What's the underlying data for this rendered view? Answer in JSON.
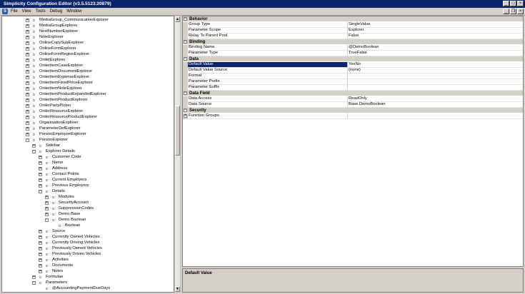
{
  "window": {
    "title": "Simplicity Configuration Editor (v3.5.5123.20879)",
    "min": "_",
    "max": "□",
    "close": "×"
  },
  "menu": {
    "app_icon": "S",
    "items": [
      "File",
      "View",
      "Tools",
      "Debug",
      "Window"
    ],
    "mdi": [
      "_",
      "❐",
      "×"
    ]
  },
  "tree": {
    "items": [
      {
        "label": "MediaGroup_CommunicationExplorer",
        "depth": 0,
        "exp": "+"
      },
      {
        "label": "MediaGroupExplorer",
        "depth": 0,
        "exp": "+"
      },
      {
        "label": "NextNumberExplorer",
        "depth": 0,
        "exp": "+"
      },
      {
        "label": "NoteExplorer",
        "depth": 0,
        "exp": "+"
      },
      {
        "label": "OnlineCopySubExplorer",
        "depth": 0,
        "exp": "+"
      },
      {
        "label": "OnlineFormExplorer",
        "depth": 0,
        "exp": "+"
      },
      {
        "label": "OnlineFormRegionExplorer",
        "depth": 0,
        "exp": "+"
      },
      {
        "label": "OrderExplorer",
        "depth": 0,
        "exp": "+"
      },
      {
        "label": "OrderItemCaseExplorer",
        "depth": 0,
        "exp": "+"
      },
      {
        "label": "OrderItemDocumentExplorer",
        "depth": 0,
        "exp": "+"
      },
      {
        "label": "OrderItemExpenseExplorer",
        "depth": 0,
        "exp": "+"
      },
      {
        "label": "OrderItemFixedPriceExplorer",
        "depth": 0,
        "exp": "+"
      },
      {
        "label": "OrderItemNoteExplorer",
        "depth": 0,
        "exp": "+"
      },
      {
        "label": "OrderItemProductExpandedExplorer",
        "depth": 0,
        "exp": "+"
      },
      {
        "label": "OrderItemProductExplorer",
        "depth": 0,
        "exp": "+"
      },
      {
        "label": "OrderPartyPicker",
        "depth": 0,
        "exp": "+"
      },
      {
        "label": "OrderResourceExplorer",
        "depth": 0,
        "exp": "+"
      },
      {
        "label": "OrderResourceProductExplorer",
        "depth": 0,
        "exp": "+"
      },
      {
        "label": "OrganisationExplorer",
        "depth": 0,
        "exp": "+"
      },
      {
        "label": "ParameterDefExplorer",
        "depth": 0,
        "exp": "+"
      },
      {
        "label": "PersonEmployeeExplorer",
        "depth": 0,
        "exp": "+"
      },
      {
        "label": "PersonExplorer",
        "depth": 0,
        "exp": "-"
      },
      {
        "label": "Sidebar",
        "depth": 1,
        "exp": "+"
      },
      {
        "label": "Explorer Details",
        "depth": 1,
        "exp": "-"
      },
      {
        "label": "Customer Code",
        "depth": 2,
        "exp": "+"
      },
      {
        "label": "Name",
        "depth": 2,
        "exp": "+"
      },
      {
        "label": "Address",
        "depth": 2,
        "exp": "+"
      },
      {
        "label": "Contact Points",
        "depth": 2,
        "exp": "+"
      },
      {
        "label": "Current Employers",
        "depth": 2,
        "exp": "+"
      },
      {
        "label": "Previous Employers",
        "depth": 2,
        "exp": "+"
      },
      {
        "label": "Details",
        "depth": 2,
        "exp": "-"
      },
      {
        "label": "Modules",
        "depth": 3,
        "exp": "+"
      },
      {
        "label": "SecurityAccount",
        "depth": 3,
        "exp": "+"
      },
      {
        "label": "SuppressionCodes",
        "depth": 3,
        "exp": "+"
      },
      {
        "label": "Demo Base",
        "depth": 3,
        "exp": "+"
      },
      {
        "label": "Demo Boolean",
        "depth": 3,
        "exp": "-"
      },
      {
        "label": "Boolean",
        "depth": 4,
        "exp": ""
      },
      {
        "label": "Source",
        "depth": 2,
        "exp": "+"
      },
      {
        "label": "Currently Owned Vehicles",
        "depth": 2,
        "exp": "+"
      },
      {
        "label": "Currently Driving Vehicles",
        "depth": 2,
        "exp": "+"
      },
      {
        "label": "Previously Owned Vehicles",
        "depth": 2,
        "exp": "+"
      },
      {
        "label": "Previously Driven Vehicles",
        "depth": 2,
        "exp": "+"
      },
      {
        "label": "Activities",
        "depth": 2,
        "exp": "+"
      },
      {
        "label": "Documents",
        "depth": 2,
        "exp": "+"
      },
      {
        "label": "Notes",
        "depth": 2,
        "exp": "+"
      },
      {
        "label": "Formulae",
        "depth": 1,
        "exp": "+"
      },
      {
        "label": "Parameters",
        "depth": 1,
        "exp": "-"
      },
      {
        "label": "@AccountingPaymentDueDays",
        "depth": 2,
        "exp": ""
      },
      {
        "label": "@ActionType_InboundCall",
        "depth": 2,
        "exp": ""
      }
    ]
  },
  "grid": {
    "rows": [
      {
        "kind": "cat",
        "label": "Behavior"
      },
      {
        "kind": "prop",
        "name": "Group Type",
        "value": "SingleValue"
      },
      {
        "kind": "prop",
        "name": "Parameter Scope",
        "value": "Explorer"
      },
      {
        "kind": "prop",
        "name": "Relay To Parent Pool",
        "value": "False"
      },
      {
        "kind": "cat",
        "label": "Binding"
      },
      {
        "kind": "prop",
        "name": "Binding Name",
        "value": "@DemoBoolean"
      },
      {
        "kind": "prop",
        "name": "Parameter Type",
        "value": "TrueFalse"
      },
      {
        "kind": "cat",
        "label": "Data"
      },
      {
        "kind": "prop",
        "name": "Default Value",
        "value": "YesNo",
        "selected": true
      },
      {
        "kind": "prop",
        "name": "Default Value Source",
        "value": "(none)"
      },
      {
        "kind": "prop",
        "name": "Format",
        "value": ""
      },
      {
        "kind": "prop",
        "name": "Parameter Prefix",
        "value": ""
      },
      {
        "kind": "prop",
        "name": "Parameter Suffix",
        "value": ""
      },
      {
        "kind": "cat",
        "label": "Data Field"
      },
      {
        "kind": "prop",
        "name": "Data Access",
        "value": "ReadOnly"
      },
      {
        "kind": "prop",
        "name": "Data Source",
        "value": "Base.DemoBoolean"
      },
      {
        "kind": "cat",
        "label": "Security"
      },
      {
        "kind": "prop",
        "name": "Function Groups",
        "value": "",
        "exp": "+"
      }
    ]
  },
  "description": {
    "title": "Default Value"
  }
}
